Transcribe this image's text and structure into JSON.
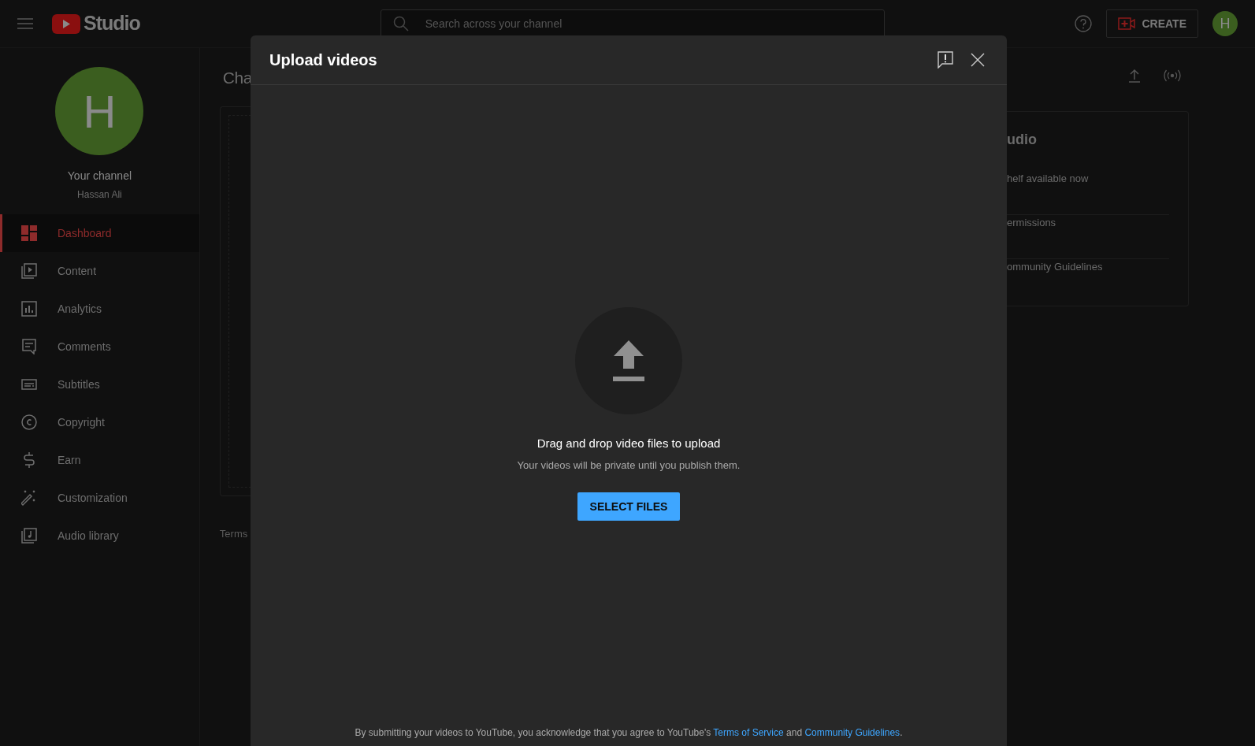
{
  "header": {
    "logo_text": "Studio",
    "search": {
      "placeholder": "Search across your channel"
    },
    "create_button": "CREATE",
    "avatar_letter": "H"
  },
  "sidebar": {
    "avatar_letter": "H",
    "channel_label": "Your channel",
    "channel_name": "Hassan Ali",
    "items": [
      {
        "label": "Dashboard",
        "selected": true
      },
      {
        "label": "Content",
        "selected": false
      },
      {
        "label": "Analytics",
        "selected": false
      },
      {
        "label": "Comments",
        "selected": false
      },
      {
        "label": "Subtitles",
        "selected": false
      },
      {
        "label": "Copyright",
        "selected": false
      },
      {
        "label": "Earn",
        "selected": false
      },
      {
        "label": "Customization",
        "selected": false
      },
      {
        "label": "Audio library",
        "selected": false
      }
    ]
  },
  "page": {
    "title": "Cha",
    "footer_link": "Terms",
    "side_card": {
      "title": "udio",
      "items": [
        "helf available now",
        "ermissions",
        "ommunity Guidelines"
      ]
    }
  },
  "dialog": {
    "title": "Upload videos",
    "heading": "Drag and drop video files to upload",
    "subtext": "Your videos will be private until you publish them.",
    "button": "SELECT FILES",
    "notice": [
      {
        "kind": "text",
        "text": "By submitting your videos to YouTube, you acknowledge that you agree to YouTube's "
      },
      {
        "kind": "link",
        "text": "Terms of Service"
      },
      {
        "kind": "text",
        "text": " and "
      },
      {
        "kind": "link",
        "text": "Community Guidelines"
      },
      {
        "kind": "text",
        "text": "."
      }
    ]
  }
}
